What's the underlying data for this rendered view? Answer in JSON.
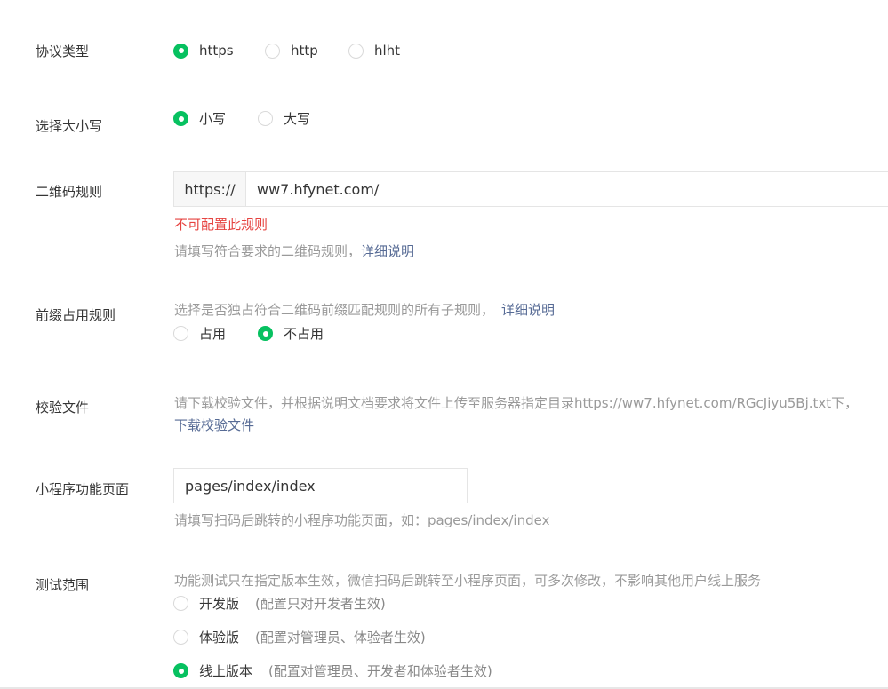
{
  "protocol": {
    "label": "协议类型",
    "options": [
      {
        "label": "https",
        "checked": true
      },
      {
        "label": "http",
        "checked": false
      },
      {
        "label": "hlht",
        "checked": false
      }
    ]
  },
  "case": {
    "label": "选择大小写",
    "options": [
      {
        "label": "小写",
        "checked": true
      },
      {
        "label": "大写",
        "checked": false
      }
    ]
  },
  "qrcode_rule": {
    "label": "二维码规则",
    "prefix": "https://",
    "value": "ww7.hfynet.com/",
    "error": "不可配置此规则",
    "help": "请填写符合要求的二维码规则，",
    "help_link": "详细说明"
  },
  "prefix_occupy": {
    "label": "前缀占用规则",
    "desc": "选择是否独占符合二维码前缀匹配规则的所有子规则，",
    "desc_link": "详细说明",
    "options": [
      {
        "label": "占用",
        "checked": false
      },
      {
        "label": "不占用",
        "checked": true
      }
    ]
  },
  "verify_file": {
    "label": "校验文件",
    "desc": "请下载校验文件，并根据说明文档要求将文件上传至服务器指定目录https://ww7.hfynet.com/RGcJiyu5Bj.txt下，",
    "download_link": "下载校验文件"
  },
  "page": {
    "label": "小程序功能页面",
    "value": "pages/index/index",
    "help": "请填写扫码后跳转的小程序功能页面，如：pages/index/index"
  },
  "test_scope": {
    "label": "测试范围",
    "desc": "功能测试只在指定版本生效，微信扫码后跳转至小程序页面，可多次修改，不影响其他用户线上服务",
    "options": [
      {
        "label": "开发版",
        "note": "(配置只对开发者生效)",
        "checked": false
      },
      {
        "label": "体验版",
        "note": "(配置对管理员、体验者生效)",
        "checked": false
      },
      {
        "label": "线上版本",
        "note": "(配置对管理员、开发者和体验者生效)",
        "checked": true
      }
    ]
  },
  "colors": {
    "accent": "#07c160",
    "error": "#e64340",
    "link": "#576b95",
    "muted": "#9a9a9a"
  }
}
